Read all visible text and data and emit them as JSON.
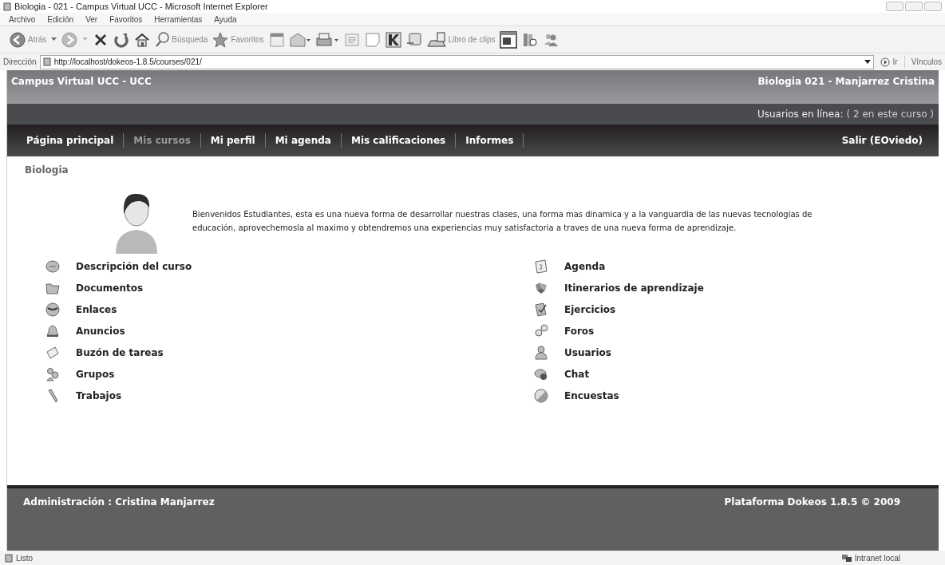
{
  "window": {
    "title": "Biologia - 021 - Campus Virtual UCC - Microsoft Internet Explorer"
  },
  "menu": [
    "Archivo",
    "Edición",
    "Ver",
    "Favoritos",
    "Herramientas",
    "Ayuda"
  ],
  "toolbar": {
    "back": "Atrás",
    "search": "Búsqueda",
    "favorites": "Favoritos",
    "clips": "Libro de clips"
  },
  "address": {
    "label": "Dirección",
    "value": "http://localhost/dokeos-1.8.5/courses/021/",
    "go": "Ir",
    "links": "Vínculos"
  },
  "header": {
    "site_title": "Campus Virtual UCC - UCC",
    "course_title": "Biologia 021 - Manjarrez Cristina",
    "online_label": "Usuarios en línea:",
    "online_count": "( 2 en este curso )"
  },
  "nav": [
    {
      "label": "Página principal",
      "selected": false
    },
    {
      "label": "Mis cursos",
      "selected": true
    },
    {
      "label": "Mi perfil",
      "selected": false
    },
    {
      "label": "Mi agenda",
      "selected": false
    },
    {
      "label": "Mis calificaciones",
      "selected": false
    },
    {
      "label": "Informes",
      "selected": false
    }
  ],
  "logout": "Salir (EOviedo)",
  "breadcrumb": "Biologia",
  "intro": "Bienvenidos Estudiantes, esta es una nueva forma de desarrollar nuestras clases,  una forma mas  dinamica y a la vanguardia de las nuevas tecnologias de educación, aprovechemosla al maximo y obtendremos una experiencias muy satisfactoria a traves de una nueva forma de aprendizaje.",
  "tools_left": [
    "Descripción del curso",
    "Documentos",
    "Enlaces",
    "Anuncios",
    "Buzón de tareas",
    "Grupos",
    "Trabajos"
  ],
  "tools_right": [
    "Agenda",
    "Itinerarios de aprendizaje",
    "Ejercicios",
    "Foros",
    "Usuarios",
    "Chat",
    "Encuestas"
  ],
  "footer": {
    "admin": "Administración : Cristina Manjarrez",
    "platform": "Plataforma Dokeos 1.8.5 © 2009"
  },
  "status_bar": {
    "status": "Listo",
    "zone": "Intranet local"
  }
}
